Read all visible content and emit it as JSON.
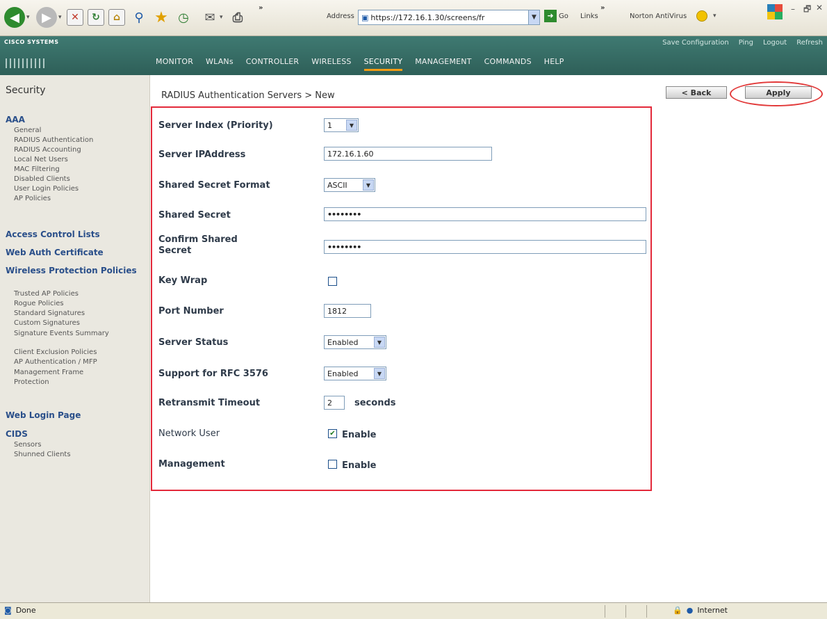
{
  "browser": {
    "address_label": "Address",
    "url": "https://172.16.1.30/screens/fr",
    "go_label": "Go",
    "links_label": "Links",
    "norton_label": "Norton AntiVirus",
    "chevron": "»"
  },
  "header": {
    "logo_text": "CISCO SYSTEMS",
    "top_links": [
      "Save Configuration",
      "Ping",
      "Logout",
      "Refresh"
    ],
    "nav": [
      "MONITOR",
      "WLANs",
      "CONTROLLER",
      "WIRELESS",
      "SECURITY",
      "MANAGEMENT",
      "COMMANDS",
      "HELP"
    ],
    "active_nav": "SECURITY",
    "accent_color": "#f39c12"
  },
  "sidebar": {
    "title": "Security",
    "sections": [
      {
        "label": "AAA",
        "items": [
          "General",
          "RADIUS Authentication",
          "RADIUS Accounting",
          "Local Net Users",
          "MAC Filtering",
          "Disabled Clients",
          "User Login Policies",
          "AP Policies"
        ]
      },
      {
        "label": "Access Control Lists",
        "items": []
      },
      {
        "label": "Web Auth Certificate",
        "items": []
      },
      {
        "label": "Wireless Protection Policies",
        "items": [
          "Trusted AP Policies",
          "Rogue Policies",
          "Standard Signatures",
          "Custom Signatures",
          "Signature Events Summary",
          "Client Exclusion Policies",
          "AP Authentication / MFP",
          "Management Frame Protection"
        ]
      },
      {
        "label": "Web Login Page",
        "items": []
      },
      {
        "label": "CIDS",
        "items": [
          "Sensors",
          "Shunned Clients"
        ]
      }
    ]
  },
  "page": {
    "breadcrumb": "RADIUS Authentication Servers > New",
    "back_label": "< Back",
    "apply_label": "Apply",
    "highlight_color": "#e3293a"
  },
  "form": {
    "server_index_label": "Server Index (Priority)",
    "server_index_value": "1",
    "server_ip_label": "Server IPAddress",
    "server_ip_value": "172.16.1.60",
    "secret_format_label": "Shared Secret Format",
    "secret_format_value": "ASCII",
    "shared_secret_label": "Shared Secret",
    "shared_secret_value": "••••••••",
    "confirm_secret_label_1": "Confirm Shared",
    "confirm_secret_label_2": "Secret",
    "confirm_secret_value": "••••••••",
    "key_wrap_label": "Key Wrap",
    "key_wrap_checked": false,
    "port_label": "Port Number",
    "port_value": "1812",
    "server_status_label": "Server Status",
    "server_status_value": "Enabled",
    "rfc_label": "Support for RFC 3576",
    "rfc_value": "Enabled",
    "retransmit_label": "Retransmit Timeout",
    "retransmit_value": "2",
    "retransmit_unit": "seconds",
    "network_user_label": "Network User",
    "network_user_checked": true,
    "network_user_enable": "Enable",
    "management_label": "Management",
    "management_checked": false,
    "management_enable": "Enable"
  },
  "status": {
    "left_text": "Done",
    "right_text": "Internet"
  }
}
